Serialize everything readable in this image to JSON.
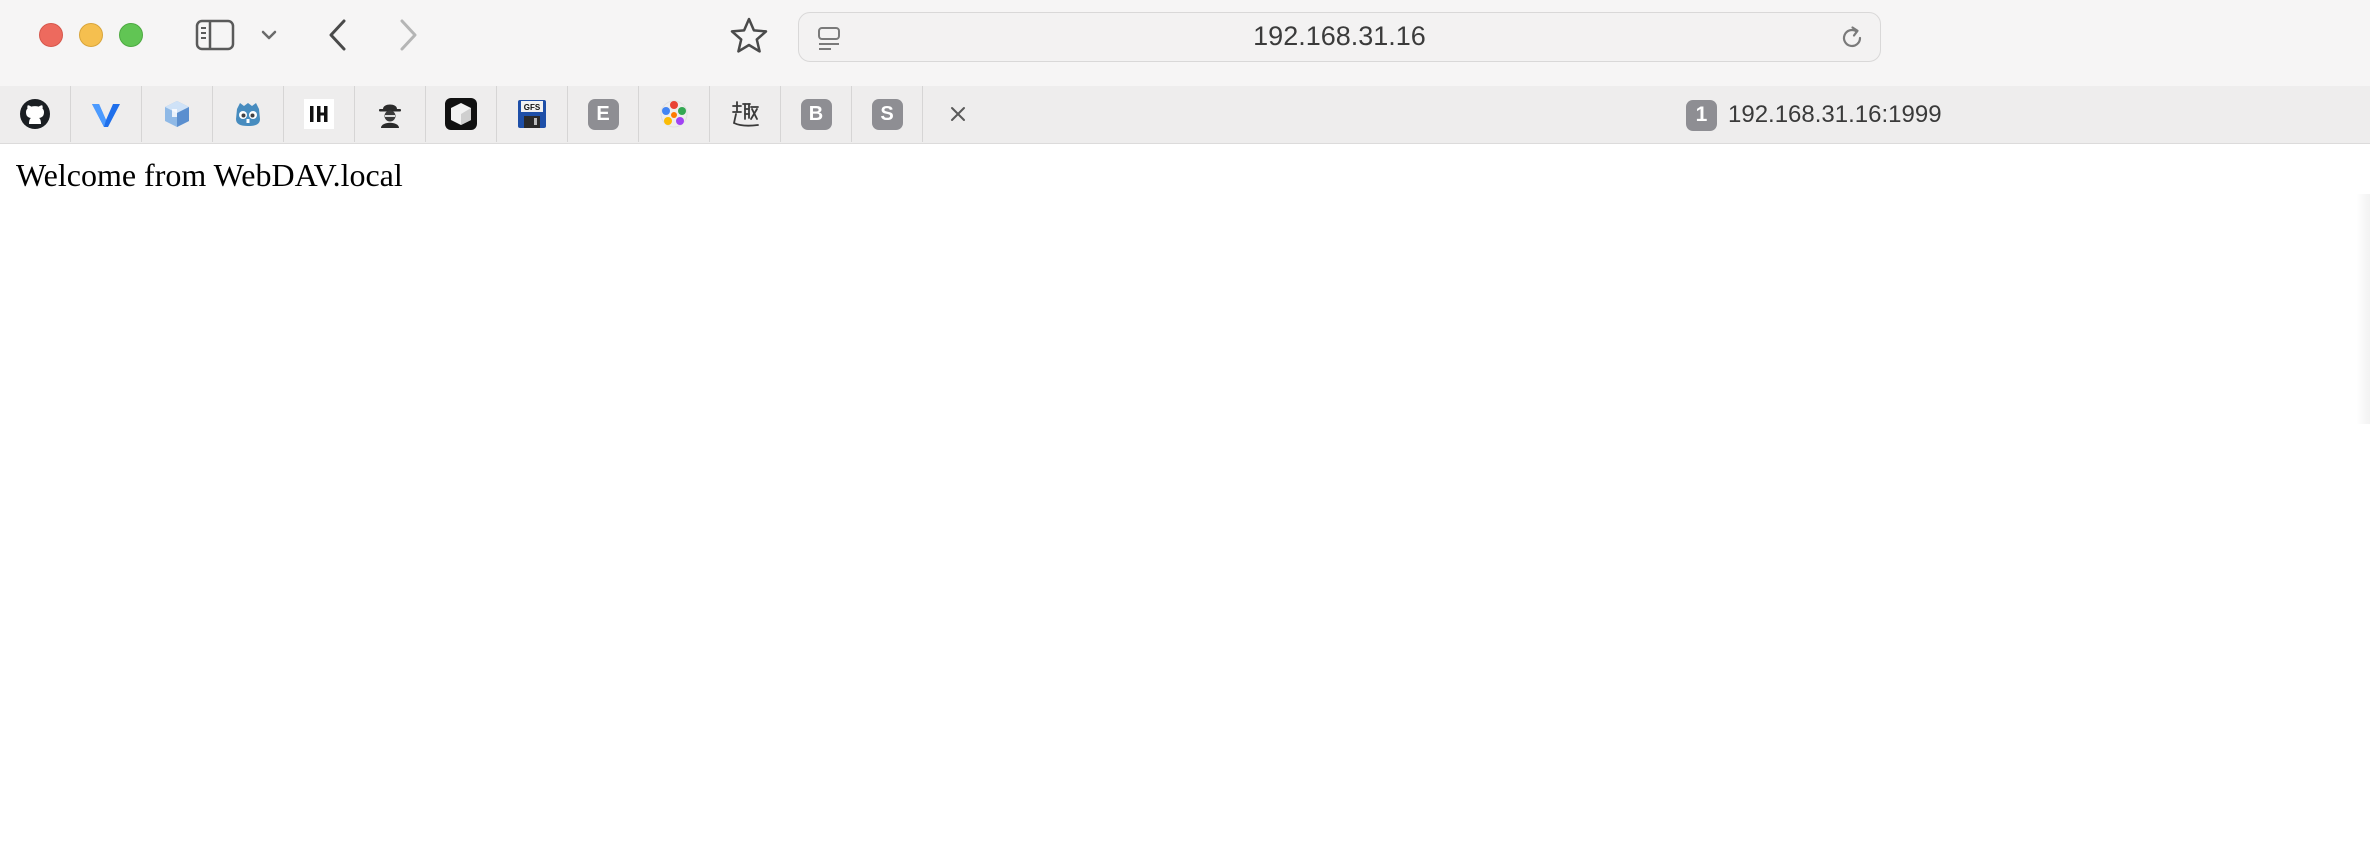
{
  "browser": {
    "address_url": "192.168.31.16",
    "buttons": {
      "close": "close-window",
      "minimize": "minimize-window",
      "zoom": "zoom-window"
    }
  },
  "pinned_tabs": [
    {
      "icon": "github-icon"
    },
    {
      "icon": "v-logo-icon"
    },
    {
      "icon": "cube-icon"
    },
    {
      "icon": "godot-icon"
    },
    {
      "icon": "ih-logo-icon",
      "text": "IH"
    },
    {
      "icon": "spy-icon"
    },
    {
      "icon": "white-cube-icon"
    },
    {
      "icon": "floppy-disk-icon",
      "text": "GFS"
    },
    {
      "icon": "letter-e-icon",
      "text": "E"
    },
    {
      "icon": "colorful-logo-icon"
    },
    {
      "icon": "qu-character-icon",
      "text": "趣"
    },
    {
      "icon": "letter-b-icon",
      "text": "B"
    },
    {
      "icon": "letter-s-icon",
      "text": "S"
    }
  ],
  "active_tab": {
    "badge": "1",
    "title": "192.168.31.16:1999"
  },
  "page": {
    "welcome_text": "Welcome from WebDAV.local"
  },
  "colors": {
    "toolbar_bg": "#f6f5f5",
    "tabbar_bg": "#eeeded",
    "traffic_red": "#ed6a5e",
    "traffic_yellow": "#f5bf4f",
    "traffic_green": "#61c554",
    "badge_gray": "#8e8e93"
  }
}
